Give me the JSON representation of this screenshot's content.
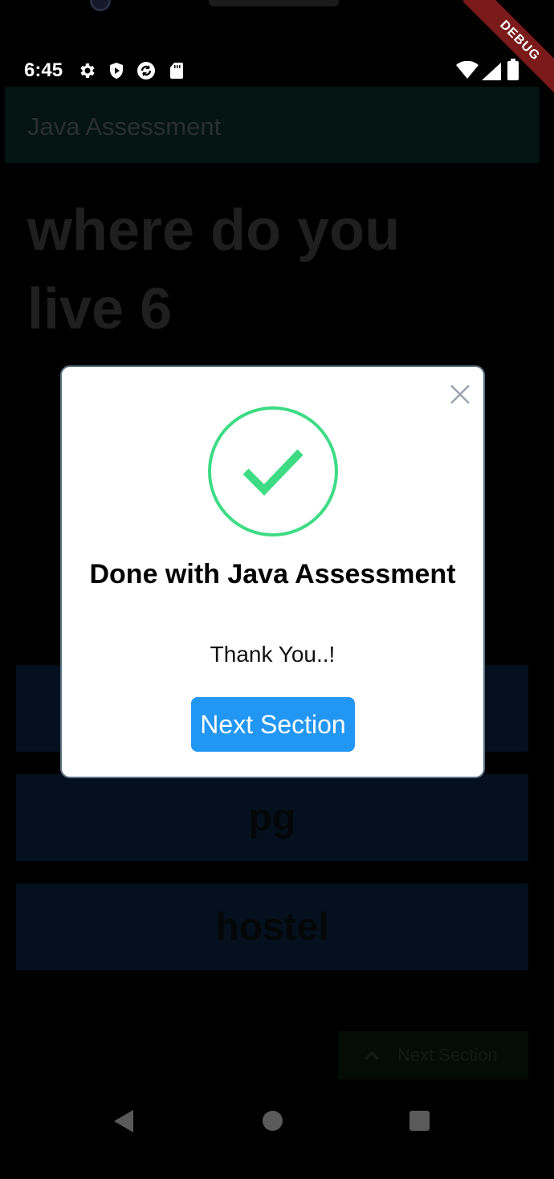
{
  "status_bar": {
    "time": "6:45",
    "icons": [
      "settings-icon",
      "play-protect-icon",
      "sync-icon",
      "sd-card-icon",
      "wifi-icon",
      "signal-icon",
      "battery-icon"
    ]
  },
  "debug_banner": "DEBUG",
  "app_bar": {
    "title": "Java Assessment"
  },
  "question": {
    "text": "where do you live 6"
  },
  "options": [
    {
      "label": ""
    },
    {
      "label": "pg"
    },
    {
      "label": "hostel"
    }
  ],
  "next_section_button": {
    "label": "Next Section",
    "icon": "chevron-up-icon"
  },
  "dialog": {
    "title": "Done with Java Assessment",
    "message": "Thank You..!",
    "button_label": "Next Section",
    "icon": "check-circle-icon",
    "close_icon": "close-icon"
  },
  "colors": {
    "accent": "#2196f3",
    "success": "#3ddc84",
    "background": "#000000",
    "dialog_bg": "#ffffff"
  },
  "nav_bar": {
    "icons": [
      "back-icon",
      "home-icon",
      "recents-icon"
    ]
  }
}
